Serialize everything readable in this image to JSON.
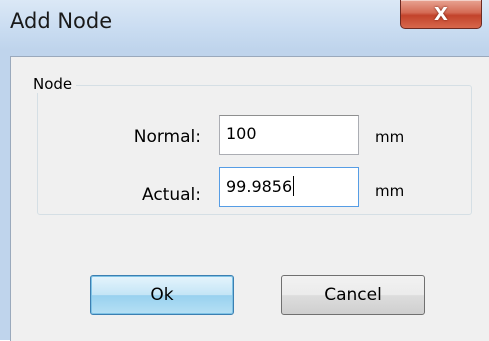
{
  "window": {
    "title": "Add Node",
    "close_glyph": "X"
  },
  "group": {
    "legend": "Node",
    "normal_label": "Normal:",
    "normal_value": "100",
    "normal_unit": "mm",
    "actual_label": "Actual:",
    "actual_value": "99.9856",
    "actual_unit": "mm"
  },
  "buttons": {
    "ok_label": "Ok",
    "cancel_label": "Cancel"
  }
}
